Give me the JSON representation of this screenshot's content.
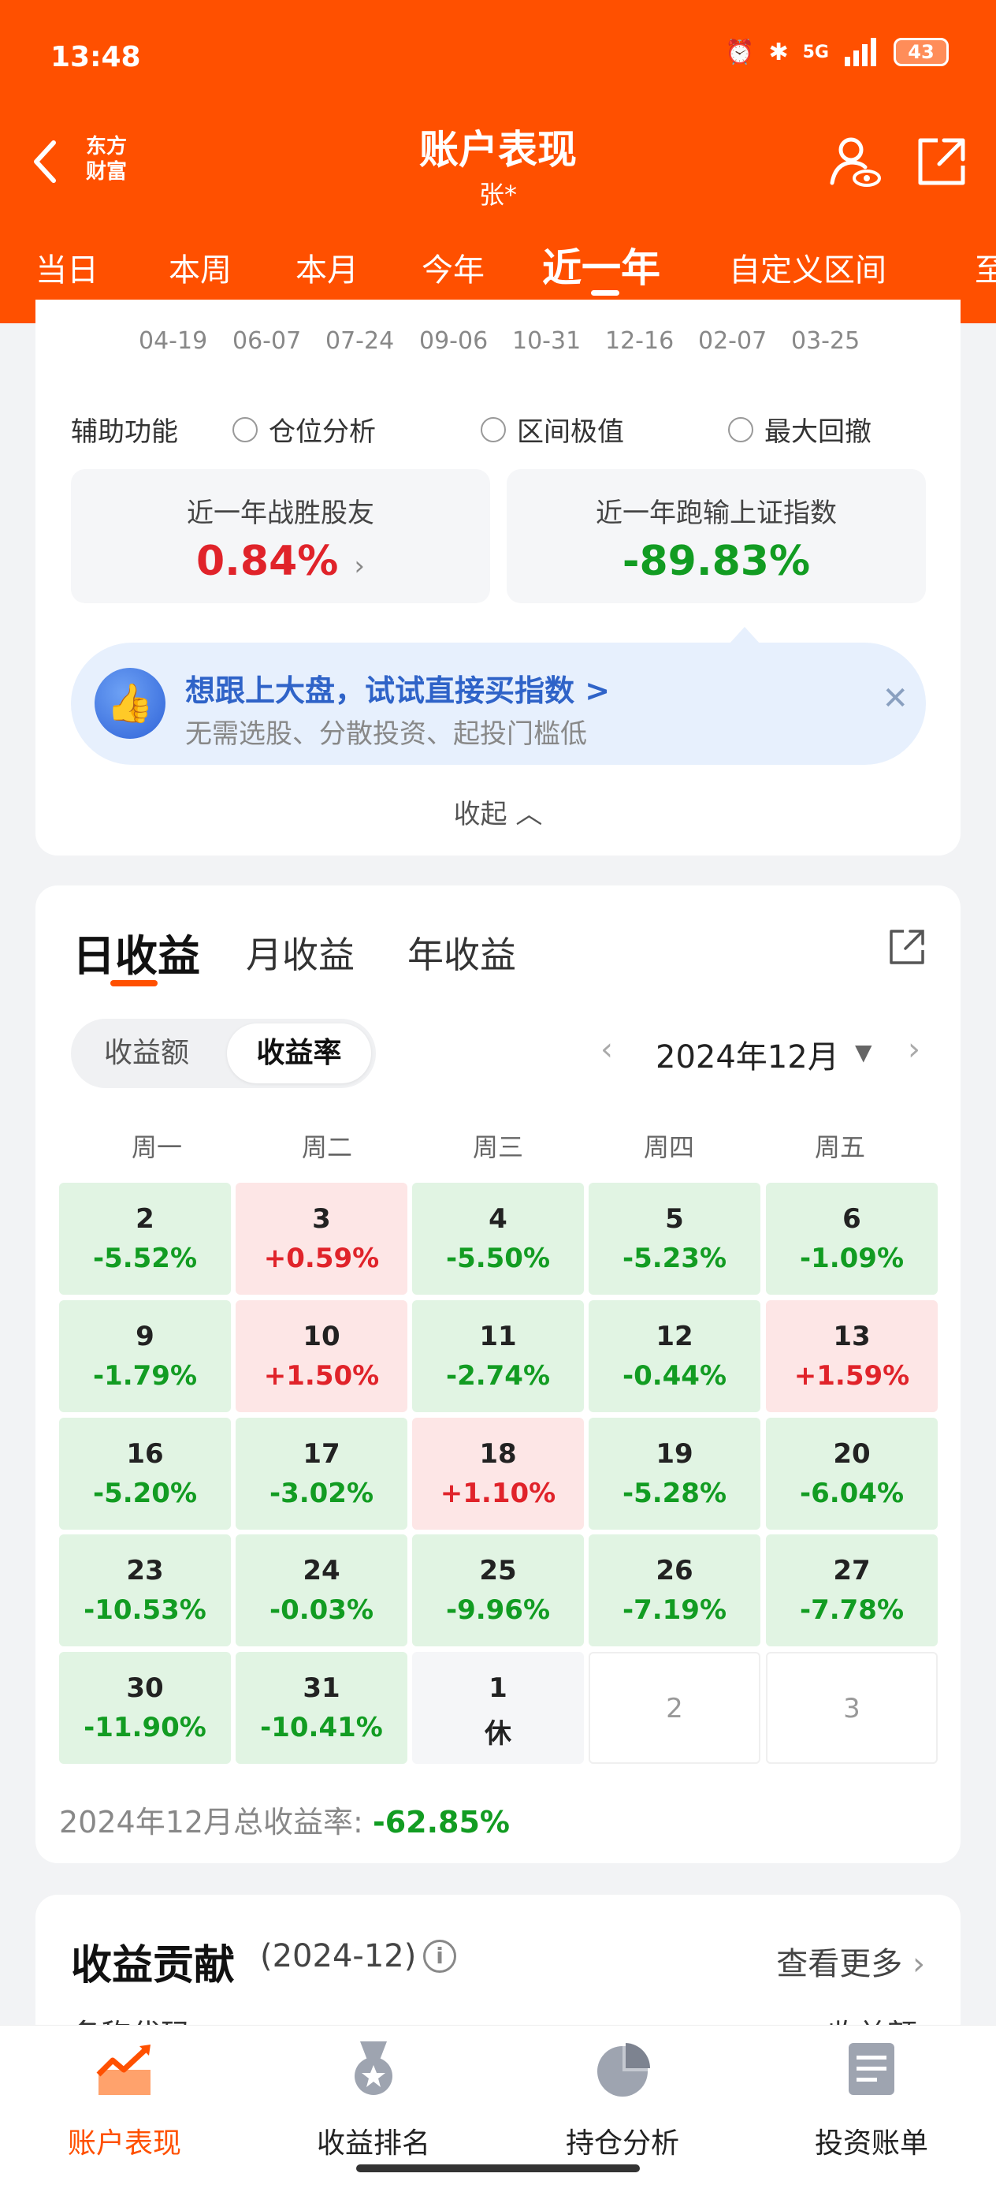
{
  "status": {
    "time": "13:48",
    "signal": "5G",
    "battery": "43"
  },
  "header": {
    "brand": "东方财富",
    "title": "账户表现",
    "subtitle": "张*",
    "tabs": [
      "当日",
      "本周",
      "本月",
      "今年",
      "近一年",
      "自定义区间",
      "至"
    ],
    "active_tab": 4
  },
  "overview": {
    "date_ticks": [
      "04-19",
      "06-07",
      "07-24",
      "09-06",
      "10-31",
      "12-16",
      "02-07",
      "03-25"
    ],
    "aux_label": "辅助功能",
    "aux_options": [
      "仓位分析",
      "区间极值",
      "最大回撤"
    ],
    "beat_label": "近一年战胜股友",
    "beat_value": "0.84%",
    "index_label": "近一年跑输上证指数",
    "index_value": "-89.83%",
    "promo_title": "想跟上大盘，试试直接买指数 >",
    "promo_sub": "无需选股、分散投资、起投门槛低",
    "collapse_label": "收起"
  },
  "returns": {
    "tabs": [
      "日收益",
      "月收益",
      "年收益"
    ],
    "segment": [
      "收益额",
      "收益率"
    ],
    "month": "2024年12月",
    "weekdays": [
      "周一",
      "周二",
      "周三",
      "周四",
      "周五"
    ],
    "weeks": [
      [
        {
          "day": "2",
          "val": "-5.52%",
          "t": "green"
        },
        {
          "day": "3",
          "val": "+0.59%",
          "t": "red"
        },
        {
          "day": "4",
          "val": "-5.50%",
          "t": "green"
        },
        {
          "day": "5",
          "val": "-5.23%",
          "t": "green"
        },
        {
          "day": "6",
          "val": "-1.09%",
          "t": "green"
        }
      ],
      [
        {
          "day": "9",
          "val": "-1.79%",
          "t": "green"
        },
        {
          "day": "10",
          "val": "+1.50%",
          "t": "red"
        },
        {
          "day": "11",
          "val": "-2.74%",
          "t": "green"
        },
        {
          "day": "12",
          "val": "-0.44%",
          "t": "green"
        },
        {
          "day": "13",
          "val": "+1.59%",
          "t": "red"
        }
      ],
      [
        {
          "day": "16",
          "val": "-5.20%",
          "t": "green"
        },
        {
          "day": "17",
          "val": "-3.02%",
          "t": "green"
        },
        {
          "day": "18",
          "val": "+1.10%",
          "t": "red"
        },
        {
          "day": "19",
          "val": "-5.28%",
          "t": "green"
        },
        {
          "day": "20",
          "val": "-6.04%",
          "t": "green"
        }
      ],
      [
        {
          "day": "23",
          "val": "-10.53%",
          "t": "green"
        },
        {
          "day": "24",
          "val": "-0.03%",
          "t": "green"
        },
        {
          "day": "25",
          "val": "-9.96%",
          "t": "green"
        },
        {
          "day": "26",
          "val": "-7.19%",
          "t": "green"
        },
        {
          "day": "27",
          "val": "-7.78%",
          "t": "green"
        }
      ],
      [
        {
          "day": "30",
          "val": "-11.90%",
          "t": "green"
        },
        {
          "day": "31",
          "val": "-10.41%",
          "t": "green"
        },
        {
          "day": "1",
          "val": "休",
          "t": "rest"
        },
        {
          "day": "2",
          "val": "",
          "t": "empty"
        },
        {
          "day": "3",
          "val": "",
          "t": "empty"
        }
      ]
    ],
    "total_label": "2024年12月总收益率: ",
    "total_value": "-62.85%"
  },
  "contribution": {
    "title": "收益贡献",
    "date": "(2024-12)",
    "more": "查看更多",
    "col_left": "名称代码",
    "col_right": "收益额"
  },
  "bottom_nav": [
    "账户表现",
    "收益排名",
    "持仓分析",
    "投资账单"
  ],
  "colors": {
    "brand": "#ff5000",
    "up": "#e0232a",
    "down": "#129c22",
    "link": "#2f63c8"
  }
}
